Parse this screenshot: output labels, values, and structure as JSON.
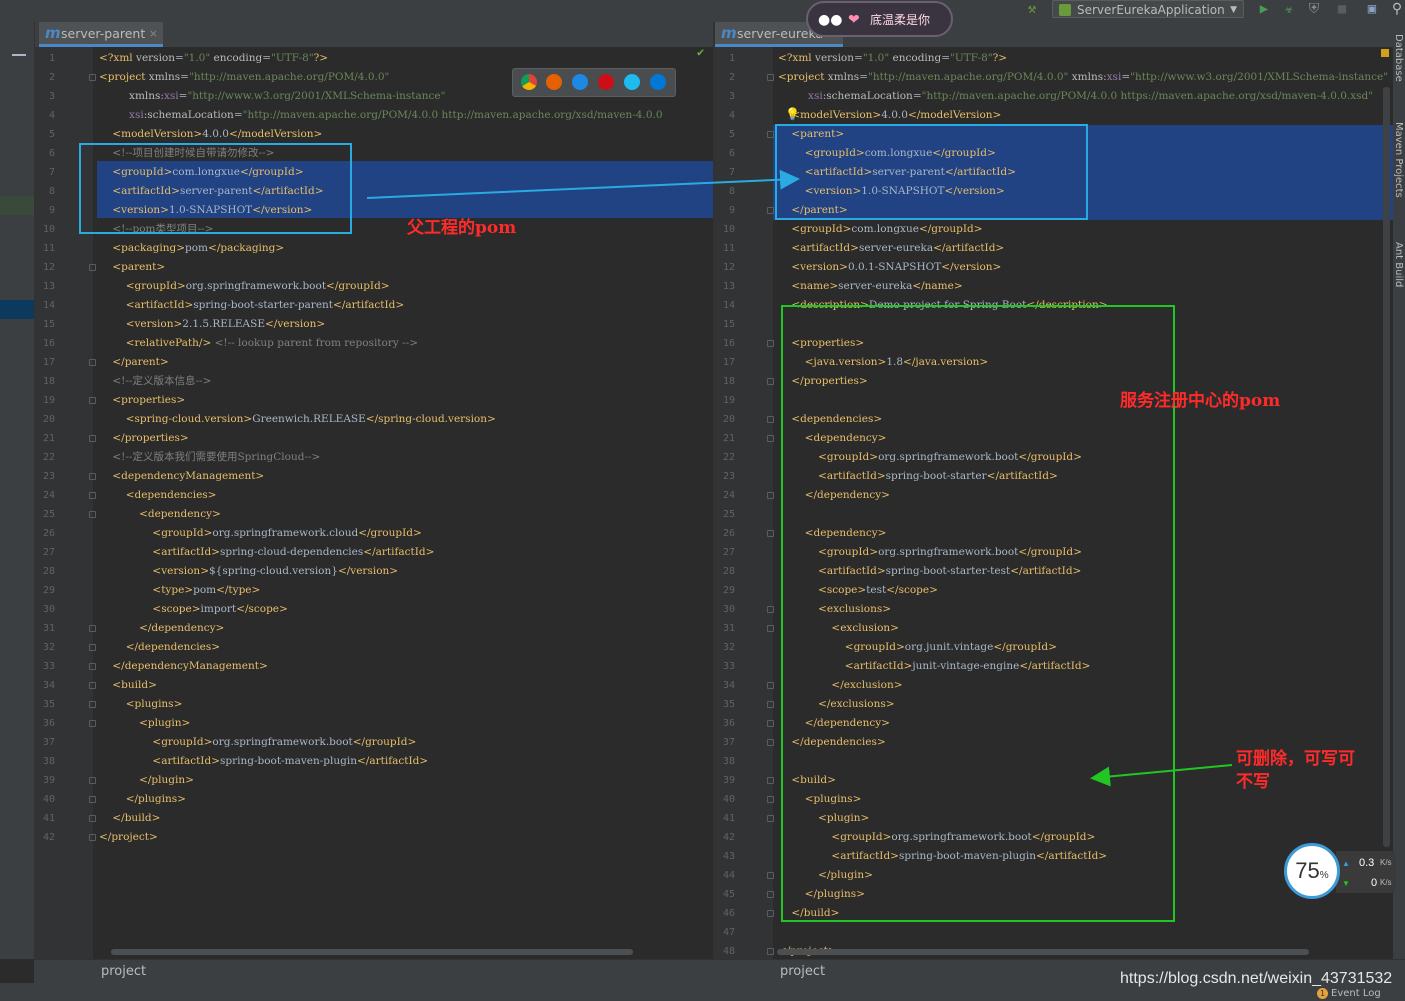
{
  "toolbar": {
    "run_config": "ServerEurekaApplication"
  },
  "left_editor": {
    "tab_title": "server-parent",
    "tab_close": "×",
    "breadcrumb": "project",
    "lines": [
      {
        "n": "1",
        "html": "<span class=\"pi\">&lt;?xml</span> <span class=\"attr\">version</span>=<span class=\"val\">\"1.0\"</span> <span class=\"attr\">encoding</span>=<span class=\"val\">\"UTF-8\"</span><span class=\"pi\">?&gt;</span>"
      },
      {
        "n": "2",
        "html": "<span class=\"tag\">&lt;project</span> <span class=\"attr\">xmlns</span>=<span class=\"val\">\"http://maven.apache.org/POM/4.0.0\"</span>"
      },
      {
        "n": "3",
        "html": "         <span class=\"attr\">xmlns:<span class=\"ns\">xsi</span></span>=<span class=\"val\">\"http://www.w3.org/2001/XMLSchema-instance\"</span>"
      },
      {
        "n": "4",
        "html": "         <span class=\"ns\">xsi</span><span class=\"attr\">:schemaLocation</span>=<span class=\"val\">\"http://maven.apache.org/POM/4.0.0 http://maven.apache.org/xsd/maven-4.0.0</span>"
      },
      {
        "n": "5",
        "html": "    <span class=\"tag\">&lt;modelVersion&gt;</span>4.0.0<span class=\"tag\">&lt;/modelVersion&gt;</span>"
      },
      {
        "n": "6",
        "html": "    <span class=\"comment\">&lt;!--项目创建时候自带请勿修改--&gt;</span>"
      },
      {
        "n": "7",
        "html": "    <span class=\"tag\">&lt;groupId&gt;</span>com.longxue<span class=\"tag\">&lt;/groupId&gt;</span>"
      },
      {
        "n": "8",
        "html": "    <span class=\"tag\">&lt;artifactId&gt;</span>server-parent<span class=\"tag\">&lt;/artifactId&gt;</span>"
      },
      {
        "n": "9",
        "html": "    <span class=\"tag\">&lt;version&gt;</span>1.0-SNAPSHOT<span class=\"tag\">&lt;/version&gt;</span>"
      },
      {
        "n": "10",
        "html": "    <span class=\"comment\">&lt;!--pom类型项目--&gt;</span>"
      },
      {
        "n": "11",
        "html": "    <span class=\"tag\">&lt;packaging&gt;</span>pom<span class=\"tag\">&lt;/packaging&gt;</span>"
      },
      {
        "n": "12",
        "html": "    <span class=\"tag\">&lt;parent&gt;</span>"
      },
      {
        "n": "13",
        "html": "        <span class=\"tag\">&lt;groupId&gt;</span>org.springframework.boot<span class=\"tag\">&lt;/groupId&gt;</span>"
      },
      {
        "n": "14",
        "html": "        <span class=\"tag\">&lt;artifactId&gt;</span>spring-boot-starter-parent<span class=\"tag\">&lt;/artifactId&gt;</span>"
      },
      {
        "n": "15",
        "html": "        <span class=\"tag\">&lt;version&gt;</span>2.1.5.RELEASE<span class=\"tag\">&lt;/version&gt;</span>"
      },
      {
        "n": "16",
        "html": "        <span class=\"tag\">&lt;relativePath/&gt;</span> <span class=\"comment\">&lt;!-- lookup parent from repository --&gt;</span>"
      },
      {
        "n": "17",
        "html": "    <span class=\"tag\">&lt;/parent&gt;</span>"
      },
      {
        "n": "18",
        "html": "    <span class=\"comment\">&lt;!--定义版本信息--&gt;</span>"
      },
      {
        "n": "19",
        "html": "    <span class=\"tag\">&lt;properties&gt;</span>"
      },
      {
        "n": "20",
        "html": "        <span class=\"tag\">&lt;spring-cloud.version&gt;</span>Greenwich.RELEASE<span class=\"tag\">&lt;/spring-cloud.version&gt;</span>"
      },
      {
        "n": "21",
        "html": "    <span class=\"tag\">&lt;/properties&gt;</span>"
      },
      {
        "n": "22",
        "html": "    <span class=\"comment\">&lt;!--定义版本我们需要使用SpringCloud--&gt;</span>"
      },
      {
        "n": "23",
        "html": "    <span class=\"tag\">&lt;dependencyManagement&gt;</span>"
      },
      {
        "n": "24",
        "html": "        <span class=\"tag\">&lt;dependencies&gt;</span>"
      },
      {
        "n": "25",
        "html": "            <span class=\"tag\">&lt;dependency&gt;</span>"
      },
      {
        "n": "26",
        "html": "                <span class=\"tag\">&lt;groupId&gt;</span>org.springframework.cloud<span class=\"tag\">&lt;/groupId&gt;</span>"
      },
      {
        "n": "27",
        "html": "                <span class=\"tag\">&lt;artifactId&gt;</span>spring-cloud-dependencies<span class=\"tag\">&lt;/artifactId&gt;</span>"
      },
      {
        "n": "28",
        "html": "                <span class=\"tag\">&lt;version&gt;</span>${spring-cloud.version}<span class=\"tag\">&lt;/version&gt;</span>"
      },
      {
        "n": "29",
        "html": "                <span class=\"tag\">&lt;type&gt;</span>pom<span class=\"tag\">&lt;/type&gt;</span>"
      },
      {
        "n": "30",
        "html": "                <span class=\"tag\">&lt;scope&gt;</span>import<span class=\"tag\">&lt;/scope&gt;</span>"
      },
      {
        "n": "31",
        "html": "            <span class=\"tag\">&lt;/dependency&gt;</span>"
      },
      {
        "n": "32",
        "html": "        <span class=\"tag\">&lt;/dependencies&gt;</span>"
      },
      {
        "n": "33",
        "html": "    <span class=\"tag\">&lt;/dependencyManagement&gt;</span>"
      },
      {
        "n": "34",
        "html": "    <span class=\"tag\">&lt;build&gt;</span>"
      },
      {
        "n": "35",
        "html": "        <span class=\"tag\">&lt;plugins&gt;</span>"
      },
      {
        "n": "36",
        "html": "            <span class=\"tag\">&lt;plugin&gt;</span>"
      },
      {
        "n": "37",
        "html": "                <span class=\"tag\">&lt;groupId&gt;</span>org.springframework.boot<span class=\"tag\">&lt;/groupId&gt;</span>"
      },
      {
        "n": "38",
        "html": "                <span class=\"tag\">&lt;artifactId&gt;</span>spring-boot-maven-plugin<span class=\"tag\">&lt;/artifactId&gt;</span>"
      },
      {
        "n": "39",
        "html": "            <span class=\"tag\">&lt;/plugin&gt;</span>"
      },
      {
        "n": "40",
        "html": "        <span class=\"tag\">&lt;/plugins&gt;</span>"
      },
      {
        "n": "41",
        "html": "    <span class=\"tag\">&lt;/build&gt;</span>"
      },
      {
        "n": "42",
        "html": "<span class=\"tag\">&lt;/project&gt;</span>"
      }
    ]
  },
  "right_editor": {
    "tab_title": "server-eureka",
    "breadcrumb": "project",
    "lines": [
      {
        "n": "1",
        "html": "<span class=\"pi\">&lt;?xml</span> <span class=\"attr\">version</span>=<span class=\"val\">\"1.0\"</span> <span class=\"attr\">encoding</span>=<span class=\"val\">\"UTF-8\"</span><span class=\"pi\">?&gt;</span>"
      },
      {
        "n": "2",
        "html": "<span class=\"tag\">&lt;project</span> <span class=\"attr\">xmlns</span>=<span class=\"val\">\"http://maven.apache.org/POM/4.0.0\"</span> <span class=\"attr\">xmlns:<span class=\"ns\">xsi</span></span>=<span class=\"val\">\"http://www.w3.org/2001/XMLSchema-instance\"</span>"
      },
      {
        "n": "3",
        "html": "         <span class=\"ns\">xsi</span><span class=\"attr\">:schemaLocation</span>=<span class=\"val\">\"http://maven.apache.org/POM/4.0.0 https://maven.apache.org/xsd/maven-4.0.0.xsd\"</span>"
      },
      {
        "n": "4",
        "html": "    <span class=\"tag\">&lt;modelVersion&gt;</span>4.0.0<span class=\"tag\">&lt;/modelVersion&gt;</span>"
      },
      {
        "n": "5",
        "html": "    <span class=\"tag\">&lt;parent&gt;</span>"
      },
      {
        "n": "6",
        "html": "        <span class=\"tag\">&lt;groupId&gt;</span>com.longxue<span class=\"tag\">&lt;/groupId&gt;</span>"
      },
      {
        "n": "7",
        "html": "        <span class=\"tag\">&lt;artifactId&gt;</span>server-parent<span class=\"tag\">&lt;/artifactId&gt;</span>"
      },
      {
        "n": "8",
        "html": "        <span class=\"tag\">&lt;version&gt;</span>1.0-SNAPSHOT<span class=\"tag\">&lt;/version&gt;</span>"
      },
      {
        "n": "9",
        "html": "    <span class=\"tag\">&lt;/parent&gt;</span>"
      },
      {
        "n": "10",
        "html": "    <span class=\"tag\">&lt;groupId&gt;</span>com.longxue<span class=\"tag\">&lt;/groupId&gt;</span>"
      },
      {
        "n": "11",
        "html": "    <span class=\"tag\">&lt;artifactId&gt;</span>server-eureka<span class=\"tag\">&lt;/artifactId&gt;</span>"
      },
      {
        "n": "12",
        "html": "    <span class=\"tag\">&lt;version&gt;</span>0.0.1-SNAPSHOT<span class=\"tag\">&lt;/version&gt;</span>"
      },
      {
        "n": "13",
        "html": "    <span class=\"tag\">&lt;name&gt;</span>server-eureka<span class=\"tag\">&lt;/name&gt;</span>"
      },
      {
        "n": "14",
        "html": "    <span class=\"tag\">&lt;description&gt;</span>Demo project for Spring Boot<span class=\"tag\">&lt;/description&gt;</span>"
      },
      {
        "n": "15",
        "html": ""
      },
      {
        "n": "16",
        "html": "    <span class=\"tag\">&lt;properties&gt;</span>"
      },
      {
        "n": "17",
        "html": "        <span class=\"tag\">&lt;java.version&gt;</span>1.8<span class=\"tag\">&lt;/java.version&gt;</span>"
      },
      {
        "n": "18",
        "html": "    <span class=\"tag\">&lt;/properties&gt;</span>"
      },
      {
        "n": "19",
        "html": ""
      },
      {
        "n": "20",
        "html": "    <span class=\"tag\">&lt;dependencies&gt;</span>"
      },
      {
        "n": "21",
        "html": "        <span class=\"tag\">&lt;dependency&gt;</span>"
      },
      {
        "n": "22",
        "html": "            <span class=\"tag\">&lt;groupId&gt;</span>org.springframework.boot<span class=\"tag\">&lt;/groupId&gt;</span>"
      },
      {
        "n": "23",
        "html": "            <span class=\"tag\">&lt;artifactId&gt;</span>spring-boot-starter<span class=\"tag\">&lt;/artifactId&gt;</span>"
      },
      {
        "n": "24",
        "html": "        <span class=\"tag\">&lt;/dependency&gt;</span>"
      },
      {
        "n": "25",
        "html": ""
      },
      {
        "n": "26",
        "html": "        <span class=\"tag\">&lt;dependency&gt;</span>"
      },
      {
        "n": "27",
        "html": "            <span class=\"tag\">&lt;groupId&gt;</span>org.springframework.boot<span class=\"tag\">&lt;/groupId&gt;</span>"
      },
      {
        "n": "28",
        "html": "            <span class=\"tag\">&lt;artifactId&gt;</span>spring-boot-starter-test<span class=\"tag\">&lt;/artifactId&gt;</span>"
      },
      {
        "n": "29",
        "html": "            <span class=\"tag\">&lt;scope&gt;</span>test<span class=\"tag\">&lt;/scope&gt;</span>"
      },
      {
        "n": "30",
        "html": "            <span class=\"tag\">&lt;exclusions&gt;</span>"
      },
      {
        "n": "31",
        "html": "                <span class=\"tag\">&lt;exclusion&gt;</span>"
      },
      {
        "n": "32",
        "html": "                    <span class=\"tag\">&lt;groupId&gt;</span>org.junit.vintage<span class=\"tag\">&lt;/groupId&gt;</span>"
      },
      {
        "n": "33",
        "html": "                    <span class=\"tag\">&lt;artifactId&gt;</span>junit-vintage-engine<span class=\"tag\">&lt;/artifactId&gt;</span>"
      },
      {
        "n": "34",
        "html": "                <span class=\"tag\">&lt;/exclusion&gt;</span>"
      },
      {
        "n": "35",
        "html": "            <span class=\"tag\">&lt;/exclusions&gt;</span>"
      },
      {
        "n": "36",
        "html": "        <span class=\"tag\">&lt;/dependency&gt;</span>"
      },
      {
        "n": "37",
        "html": "    <span class=\"tag\">&lt;/dependencies&gt;</span>"
      },
      {
        "n": "38",
        "html": ""
      },
      {
        "n": "39",
        "html": "    <span class=\"tag\">&lt;build&gt;</span>"
      },
      {
        "n": "40",
        "html": "        <span class=\"tag\">&lt;plugins&gt;</span>"
      },
      {
        "n": "41",
        "html": "            <span class=\"tag\">&lt;plugin&gt;</span>"
      },
      {
        "n": "42",
        "html": "                <span class=\"tag\">&lt;groupId&gt;</span>org.springframework.boot<span class=\"tag\">&lt;/groupId&gt;</span>"
      },
      {
        "n": "43",
        "html": "                <span class=\"tag\">&lt;artifactId&gt;</span>spring-boot-maven-plugin<span class=\"tag\">&lt;/artifactId&gt;</span>"
      },
      {
        "n": "44",
        "html": "            <span class=\"tag\">&lt;/plugin&gt;</span>"
      },
      {
        "n": "45",
        "html": "        <span class=\"tag\">&lt;/plugins&gt;</span>"
      },
      {
        "n": "46",
        "html": "    <span class=\"tag\">&lt;/build&gt;</span>"
      },
      {
        "n": "47",
        "html": ""
      },
      {
        "n": "48",
        "html": "<span class=\"tag\">&lt;/project&gt;</span>"
      }
    ]
  },
  "right_tool_windows": [
    "Database",
    "Maven Projects",
    "Ant Build"
  ],
  "annotations": {
    "parent_pom_label": "父工程的pom",
    "eureka_pom_label": "服务注册中心的pom",
    "removable_label_line1": "可删除，可写可",
    "removable_label_line2": "不写"
  },
  "sticker_text": "底温柔是你",
  "network_widget": {
    "percent": "75",
    "percent_unit": "%",
    "upload": "0.3",
    "download": "0",
    "unit": "K/s"
  },
  "watermark": "https://blog.csdn.net/weixin_43731532",
  "status": {
    "event_log": "Event Log",
    "event_badge": "1"
  },
  "colors": {
    "selection": "#214283",
    "annotation_blue": "#29abe2",
    "annotation_green": "#21c624",
    "annotation_red": "#ff2b2b"
  }
}
